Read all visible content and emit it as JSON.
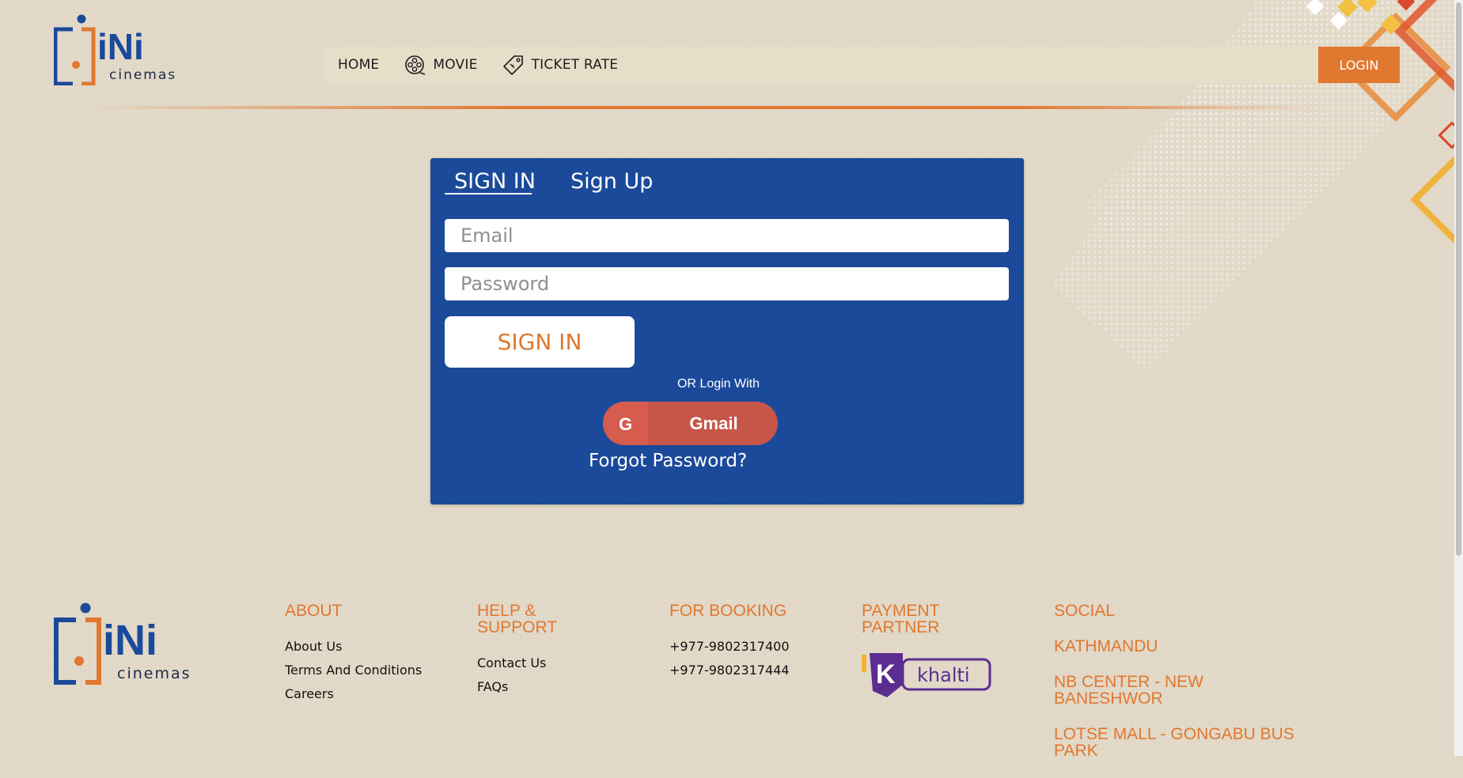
{
  "brand": {
    "logo_word": "iNi",
    "logo_sub": "cinemas",
    "colors": {
      "blue": "#1b4a9a",
      "orange": "#e0782f",
      "background": "#e2d9c8"
    }
  },
  "nav": {
    "items": [
      {
        "label": "HOME",
        "icon": null
      },
      {
        "label": "MOVIE",
        "icon": "film-reel-icon"
      },
      {
        "label": "TICKET RATE",
        "icon": "ticket-tag-icon"
      }
    ],
    "login_label": "LOGIN"
  },
  "auth": {
    "tabs": {
      "signin": "SIGN IN",
      "signup": "Sign Up"
    },
    "email_placeholder": "Email",
    "password_placeholder": "Password",
    "signin_button": "SIGN IN",
    "or_text": "OR Login With",
    "gmail_icon_letter": "G",
    "gmail_label": "Gmail",
    "forgot_password": "Forgot Password?"
  },
  "footer": {
    "about": {
      "heading": "ABOUT",
      "links": [
        "About Us",
        "Terms And Conditions",
        "Careers"
      ]
    },
    "help": {
      "heading": "HELP & SUPPORT",
      "links": [
        "Contact Us",
        "FAQs"
      ]
    },
    "booking": {
      "heading": "FOR BOOKING",
      "phones": [
        "+977-9802317400",
        "+977-9802317444"
      ]
    },
    "payment": {
      "heading": "PAYMENT PARTNER",
      "partner_mark": "K",
      "partner": "khalti"
    },
    "social": {
      "heading": "SOCIAL",
      "items": [
        "KATHMANDU",
        "NB CENTER  - NEW BANESHWOR",
        "LOTSE MALL  - GONGABU BUS PARK"
      ]
    }
  }
}
